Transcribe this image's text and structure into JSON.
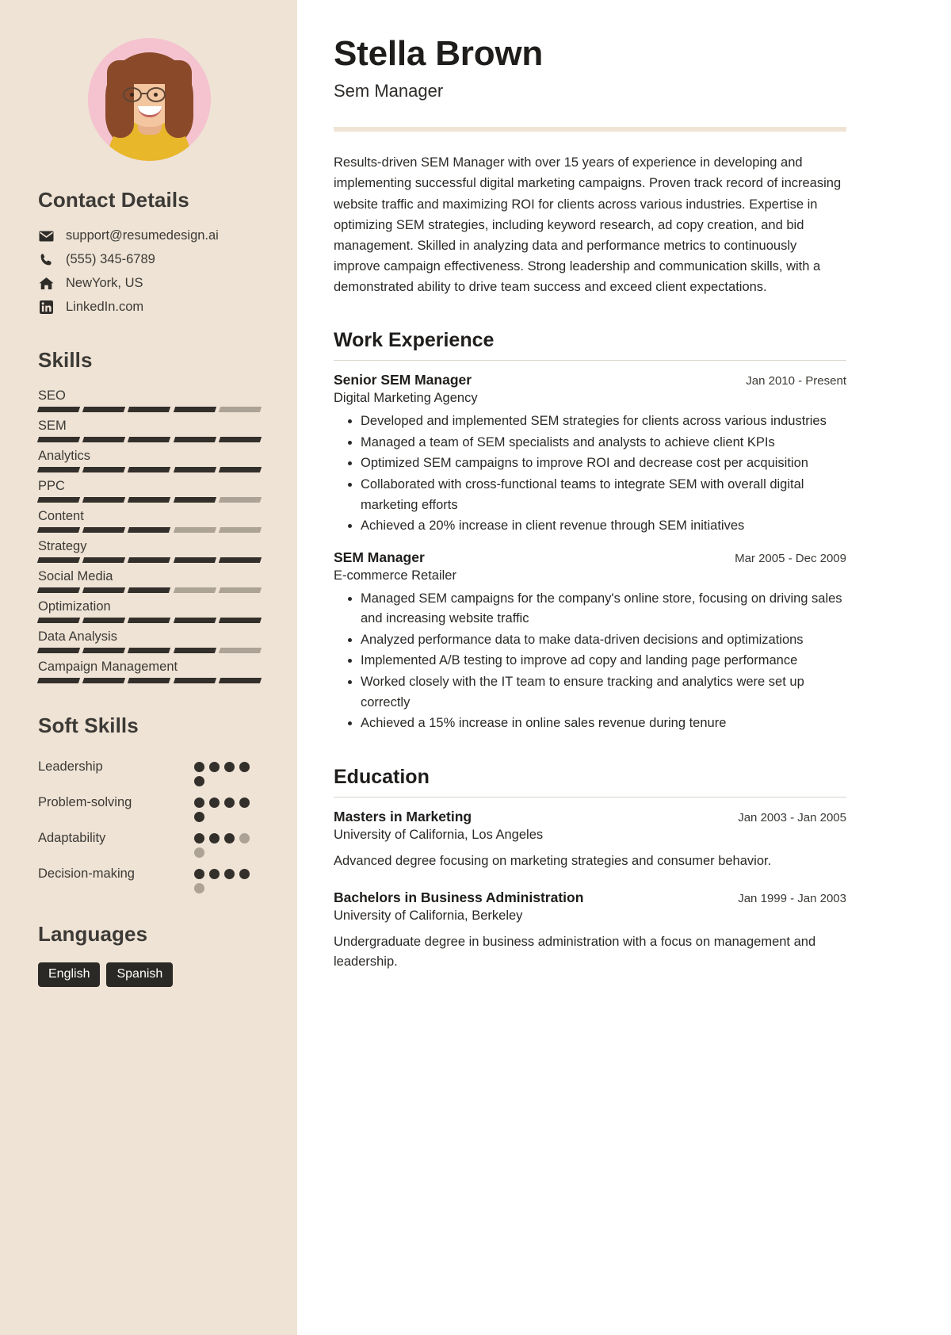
{
  "sidebar": {
    "avatar": {
      "name": "profile-photo",
      "alt": "Portrait of Stella Brown"
    },
    "contact": {
      "heading": "Contact Details",
      "items": [
        {
          "icon": "email-icon",
          "value": "support@resumedesign.ai"
        },
        {
          "icon": "phone-icon",
          "value": "(555) 345-6789"
        },
        {
          "icon": "home-icon",
          "value": "NewYork, US"
        },
        {
          "icon": "linkedin-icon",
          "value": "LinkedIn.com"
        }
      ]
    },
    "skills": {
      "heading": "Skills",
      "max": 5,
      "items": [
        {
          "label": "SEO",
          "level": 4
        },
        {
          "label": "SEM",
          "level": 5
        },
        {
          "label": "Analytics",
          "level": 5
        },
        {
          "label": "PPC",
          "level": 4
        },
        {
          "label": "Content",
          "level": 3
        },
        {
          "label": "Strategy",
          "level": 5
        },
        {
          "label": "Social Media",
          "level": 3
        },
        {
          "label": "Optimization",
          "level": 5
        },
        {
          "label": "Data Analysis",
          "level": 4
        },
        {
          "label": "Campaign Management",
          "level": 5
        }
      ]
    },
    "soft_skills": {
      "heading": "Soft Skills",
      "max": 5,
      "items": [
        {
          "label": "Leadership",
          "level": 5
        },
        {
          "label": "Problem-solving",
          "level": 5
        },
        {
          "label": "Adaptability",
          "level": 3
        },
        {
          "label": "Decision-making",
          "level": 4
        }
      ]
    },
    "languages": {
      "heading": "Languages",
      "items": [
        "English",
        "Spanish"
      ]
    }
  },
  "main": {
    "name": "Stella Brown",
    "job_title": "Sem Manager",
    "summary": "Results-driven SEM Manager with over 15 years of experience in developing and implementing successful digital marketing campaigns. Proven track record of increasing website traffic and maximizing ROI for clients across various industries. Expertise in optimizing SEM strategies, including keyword research, ad copy creation, and bid management. Skilled in analyzing data and performance metrics to continuously improve campaign effectiveness. Strong leadership and communication skills, with a demonstrated ability to drive team success and exceed client expectations.",
    "work": {
      "heading": "Work Experience",
      "entries": [
        {
          "title": "Senior SEM Manager",
          "date": "Jan 2010 - Present",
          "org": "Digital Marketing Agency",
          "bullets": [
            "Developed and implemented SEM strategies for clients across various industries",
            "Managed a team of SEM specialists and analysts to achieve client KPIs",
            "Optimized SEM campaigns to improve ROI and decrease cost per acquisition",
            "Collaborated with cross-functional teams to integrate SEM with overall digital marketing efforts",
            "Achieved a 20% increase in client revenue through SEM initiatives"
          ]
        },
        {
          "title": "SEM Manager",
          "date": "Mar 2005 - Dec 2009",
          "org": "E-commerce Retailer",
          "bullets": [
            "Managed SEM campaigns for the company's online store, focusing on driving sales and increasing website traffic",
            "Analyzed performance data to make data-driven decisions and optimizations",
            "Implemented A/B testing to improve ad copy and landing page performance",
            "Worked closely with the IT team to ensure tracking and analytics were set up correctly",
            "Achieved a 15% increase in online sales revenue during tenure"
          ]
        }
      ]
    },
    "education": {
      "heading": "Education",
      "entries": [
        {
          "title": "Masters in Marketing",
          "date": "Jan 2003 - Jan 2005",
          "org": "University of California, Los Angeles",
          "desc": "Advanced degree focusing on marketing strategies and consumer behavior."
        },
        {
          "title": "Bachelors in Business Administration",
          "date": "Jan 1999 - Jan 2003",
          "org": "University of California, Berkeley",
          "desc": "Undergraduate degree in business administration with a focus on management and leadership."
        }
      ]
    }
  },
  "colors": {
    "sidebar_bg": "#EFE3D5",
    "text_dark": "#2B2926",
    "bar_on": "#332F2B",
    "bar_off": "#ADA296",
    "tag_bg": "#2B2926"
  }
}
